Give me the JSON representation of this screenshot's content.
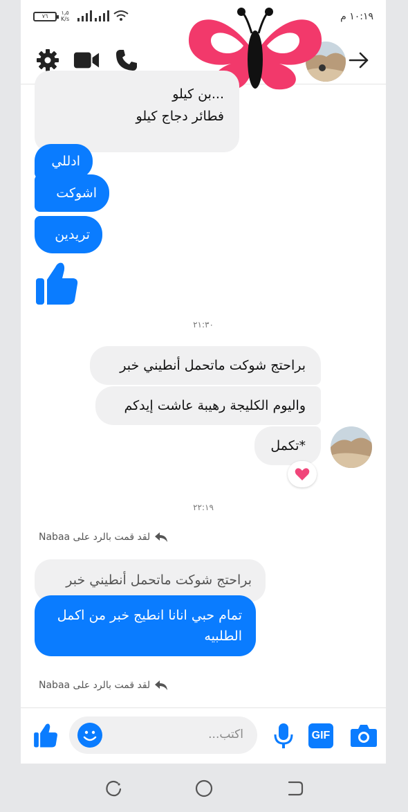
{
  "status_bar": {
    "time": "١٠:١٩ م",
    "battery": "٧٦",
    "speed_top": "١٫٥",
    "speed_unit": "K/s"
  },
  "header": {
    "icons": [
      "gear-icon",
      "video-icon",
      "phone-icon",
      "back-arrow-icon"
    ]
  },
  "messages": {
    "partial_line_1": "...بن كيلو",
    "partial_line_2": "فطائر دجاج كيلو",
    "sent_1": "ادللي",
    "sent_2": "اشوكت",
    "sent_3": "تريدين",
    "timestamp_1": "٢١:٣٠",
    "recv_1": "براحتج شوكت ماتحمل أنطيني خبر",
    "recv_2": "واليوم الكليجة رهيبة عاشت إيدكم",
    "recv_3": "*تكمل",
    "timestamp_2": "٢٢:١٩",
    "reply_note_1": "لقد قمت بالرد على Nabaa",
    "quoted": "براحتج شوكت ماتحمل أنطيني خبر",
    "sent_reply": "تمام حبي انانا انطيج خبر من اكمل الطلبيه",
    "reply_note_2": "لقد قمت بالرد على Nabaa"
  },
  "composer": {
    "placeholder": "اكتب..."
  },
  "colors": {
    "accent": "#0a7cff",
    "bubble_gray": "#f0f0f1",
    "butterfly": "#f2396b",
    "reaction": "#f0467a"
  }
}
